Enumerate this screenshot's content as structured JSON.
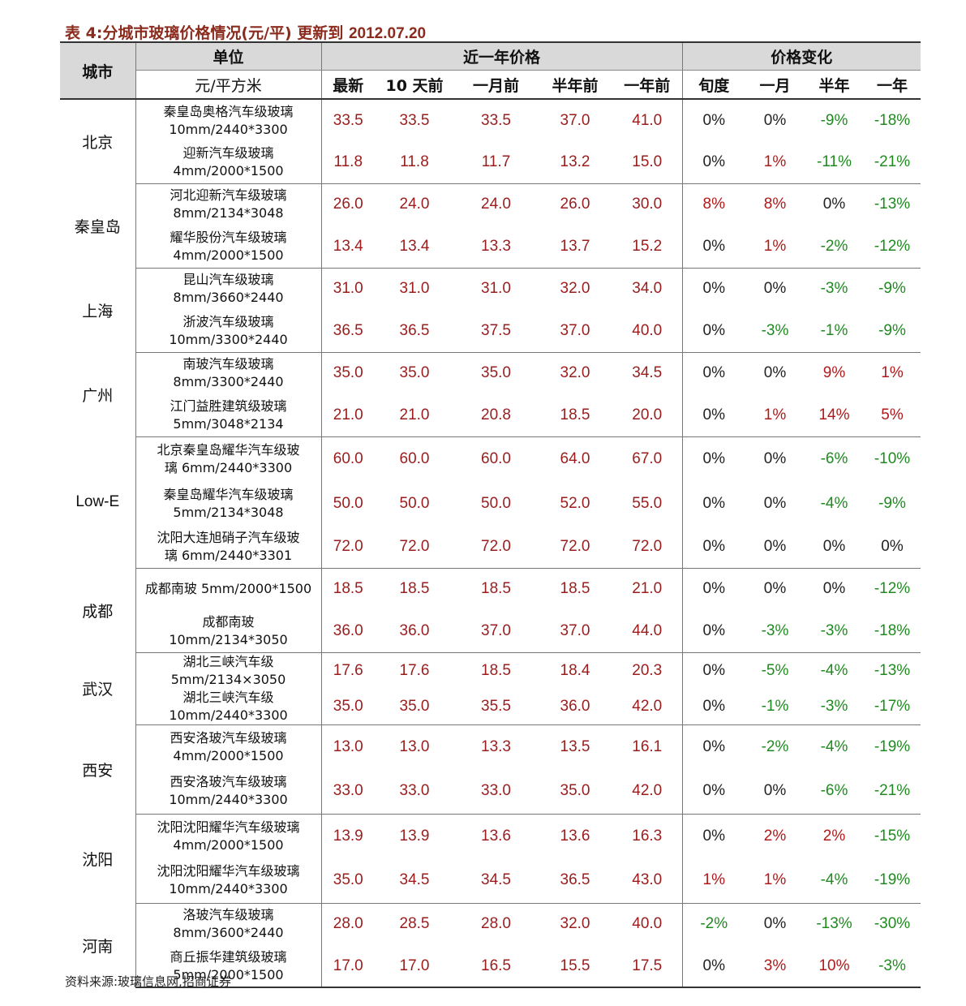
{
  "title": {
    "prefix": "表 4:分城市玻璃价格情况(元/平) 更新到 ",
    "date": "2012.07.20"
  },
  "headers": {
    "city": "城市",
    "unit_group": "单位",
    "unit_sub": "元/平方米",
    "price_group": "近一年价格",
    "change_group": "价格变化",
    "price_cols": [
      "最新",
      "10 天前",
      "一月前",
      "半年前",
      "一年前"
    ],
    "change_cols": [
      "旬度",
      "一月",
      "半年",
      "一年"
    ]
  },
  "groups": [
    {
      "city": "北京",
      "rows": [
        {
          "product": [
            "秦皇岛奥格汽车级玻璃",
            "10mm/2440*3300"
          ],
          "prices": [
            "33.5",
            "33.5",
            "33.5",
            "37.0",
            "41.0"
          ],
          "changes": [
            "0%",
            "0%",
            "-9%",
            "-18%"
          ]
        },
        {
          "product": [
            "迎新汽车级玻璃",
            "4mm/2000*1500"
          ],
          "prices": [
            "11.8",
            "11.8",
            "11.7",
            "13.2",
            "15.0"
          ],
          "changes": [
            "0%",
            "1%",
            "-11%",
            "-21%"
          ]
        }
      ]
    },
    {
      "city": "秦皇岛",
      "rows": [
        {
          "product": [
            "河北迎新汽车级玻璃",
            "8mm/2134*3048"
          ],
          "prices": [
            "26.0",
            "24.0",
            "24.0",
            "26.0",
            "30.0"
          ],
          "changes": [
            "8%",
            "8%",
            "0%",
            "-13%"
          ]
        },
        {
          "product": [
            "耀华股份汽车级玻璃",
            "4mm/2000*1500"
          ],
          "prices": [
            "13.4",
            "13.4",
            "13.3",
            "13.7",
            "15.2"
          ],
          "changes": [
            "0%",
            "1%",
            "-2%",
            "-12%"
          ]
        }
      ]
    },
    {
      "city": "上海",
      "rows": [
        {
          "product": [
            "昆山汽车级玻璃",
            "8mm/3660*2440"
          ],
          "prices": [
            "31.0",
            "31.0",
            "31.0",
            "32.0",
            "34.0"
          ],
          "changes": [
            "0%",
            "0%",
            "-3%",
            "-9%"
          ]
        },
        {
          "product": [
            "浙波汽车级玻璃",
            "10mm/3300*2440"
          ],
          "prices": [
            "36.5",
            "36.5",
            "37.5",
            "37.0",
            "40.0"
          ],
          "changes": [
            "0%",
            "-3%",
            "-1%",
            "-9%"
          ]
        }
      ]
    },
    {
      "city": "广州",
      "rows": [
        {
          "product": [
            "南玻汽车级玻璃",
            "8mm/3300*2440"
          ],
          "prices": [
            "35.0",
            "35.0",
            "35.0",
            "32.0",
            "34.5"
          ],
          "changes": [
            "0%",
            "0%",
            "9%",
            "1%"
          ]
        },
        {
          "product": [
            "江门益胜建筑级玻璃",
            "5mm/3048*2134"
          ],
          "prices": [
            "21.0",
            "21.0",
            "20.8",
            "18.5",
            "20.0"
          ],
          "changes": [
            "0%",
            "1%",
            "14%",
            "5%"
          ]
        }
      ]
    },
    {
      "city": "Low-E",
      "rows": [
        {
          "product": [
            "北京秦皇岛耀华汽车级玻",
            "璃 6mm/2440*3300"
          ],
          "prices": [
            "60.0",
            "60.0",
            "60.0",
            "64.0",
            "67.0"
          ],
          "changes": [
            "0%",
            "0%",
            "-6%",
            "-10%"
          ]
        },
        {
          "product": [
            "秦皇岛耀华汽车级玻璃",
            "5mm/2134*3048"
          ],
          "prices": [
            "50.0",
            "50.0",
            "50.0",
            "52.0",
            "55.0"
          ],
          "changes": [
            "0%",
            "0%",
            "-4%",
            "-9%"
          ]
        },
        {
          "product": [
            "沈阳大连旭硝子汽车级玻",
            "璃 6mm/2440*3301"
          ],
          "prices": [
            "72.0",
            "72.0",
            "72.0",
            "72.0",
            "72.0"
          ],
          "changes": [
            "0%",
            "0%",
            "0%",
            "0%"
          ]
        }
      ]
    },
    {
      "city": "成都",
      "rows": [
        {
          "product": [
            "成都南玻 5mm/2000*1500"
          ],
          "prices": [
            "18.5",
            "18.5",
            "18.5",
            "18.5",
            "21.0"
          ],
          "changes": [
            "0%",
            "0%",
            "0%",
            "-12%"
          ]
        },
        {
          "product": [
            "成都南玻",
            "10mm/2134*3050"
          ],
          "prices": [
            "36.0",
            "36.0",
            "37.0",
            "37.0",
            "44.0"
          ],
          "changes": [
            "0%",
            "-3%",
            "-3%",
            "-18%"
          ]
        }
      ]
    },
    {
      "city": "武汉",
      "rows": [
        {
          "product": [
            "湖北三峡汽车级",
            "5mm/2134×3050"
          ],
          "prices": [
            "17.6",
            "17.6",
            "18.5",
            "18.4",
            "20.3"
          ],
          "changes": [
            "0%",
            "-5%",
            "-4%",
            "-13%"
          ]
        },
        {
          "product": [
            "湖北三峡汽车级",
            "10mm/2440*3300"
          ],
          "prices": [
            "35.0",
            "35.0",
            "35.5",
            "36.0",
            "42.0"
          ],
          "changes": [
            "0%",
            "-1%",
            "-3%",
            "-17%"
          ]
        }
      ]
    },
    {
      "city": "西安",
      "rows": [
        {
          "product": [
            "西安洛玻汽车级玻璃",
            "4mm/2000*1500"
          ],
          "prices": [
            "13.0",
            "13.0",
            "13.3",
            "13.5",
            "16.1"
          ],
          "changes": [
            "0%",
            "-2%",
            "-4%",
            "-19%"
          ]
        },
        {
          "product": [
            "西安洛玻汽车级玻璃",
            "10mm/2440*3300"
          ],
          "prices": [
            "33.0",
            "33.0",
            "33.0",
            "35.0",
            "42.0"
          ],
          "changes": [
            "0%",
            "0%",
            "-6%",
            "-21%"
          ]
        }
      ]
    },
    {
      "city": "沈阳",
      "rows": [
        {
          "product": [
            "沈阳沈阳耀华汽车级玻璃",
            "4mm/2000*1500"
          ],
          "prices": [
            "13.9",
            "13.9",
            "13.6",
            "13.6",
            "16.3"
          ],
          "changes": [
            "0%",
            "2%",
            "2%",
            "-15%"
          ]
        },
        {
          "product": [
            "沈阳沈阳耀华汽车级玻璃",
            "10mm/2440*3300"
          ],
          "prices": [
            "35.0",
            "34.5",
            "34.5",
            "36.5",
            "43.0"
          ],
          "changes": [
            "1%",
            "1%",
            "-4%",
            "-19%"
          ]
        }
      ]
    },
    {
      "city": "河南",
      "rows": [
        {
          "product": [
            "洛玻汽车级玻璃",
            "8mm/3600*2440"
          ],
          "prices": [
            "28.0",
            "28.5",
            "28.0",
            "32.0",
            "40.0"
          ],
          "changes": [
            "-2%",
            "0%",
            "-13%",
            "-30%"
          ]
        },
        {
          "product": [
            "商丘振华建筑级玻璃",
            "5mm/2000*1500"
          ],
          "prices": [
            "17.0",
            "17.0",
            "16.5",
            "15.5",
            "17.5"
          ],
          "changes": [
            "0%",
            "3%",
            "10%",
            "-3%"
          ]
        }
      ]
    }
  ],
  "source": "资料来源:玻璃信息网,招商证券",
  "colors": {
    "positive": "#b01919",
    "negative": "#1f8a1f",
    "price": "#9b1c1c",
    "title": "#8b2b1e",
    "header_bg": "#d9d9d9"
  }
}
